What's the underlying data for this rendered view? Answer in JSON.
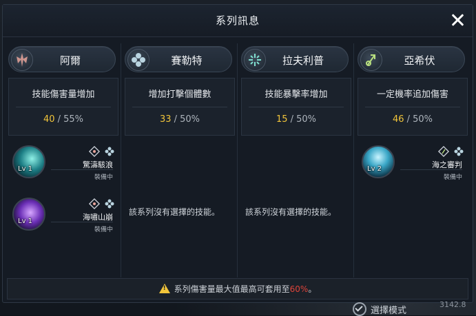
{
  "dialog": {
    "title": "系列訊息"
  },
  "columns": [
    {
      "name": "阿爾",
      "stat_label": "技能傷害量增加",
      "current": "40",
      "max": "55%",
      "skills": [
        {
          "name": "驚濤駭浪",
          "level": "Lv 1",
          "status": "裝備中"
        },
        {
          "name": "海嘯山崩",
          "level": "Lv 1",
          "status": "裝備中"
        }
      ]
    },
    {
      "name": "賽勒特",
      "stat_label": "增加打擊個體數",
      "current": "33",
      "max": "50%",
      "empty_message": "該系列沒有選擇的技能。"
    },
    {
      "name": "拉夫利普",
      "stat_label": "技能暴擊率增加",
      "current": "15",
      "max": "50%",
      "empty_message": "該系列沒有選擇的技能。"
    },
    {
      "name": "亞希伏",
      "stat_label": "一定機率追加傷害",
      "current": "46",
      "max": "50%",
      "skills": [
        {
          "name": "海之審判",
          "level": "Lv 2",
          "status": "裝備中"
        }
      ]
    }
  ],
  "footer": {
    "text_before": "系列傷害量最大值最高可套用至",
    "highlight": "60%",
    "text_after": "。"
  },
  "bottom_bar": {
    "mode_label": "選擇模式",
    "coord": "3142.8"
  },
  "colors": {
    "gold": "#f2c53a",
    "red": "#e0443a"
  }
}
